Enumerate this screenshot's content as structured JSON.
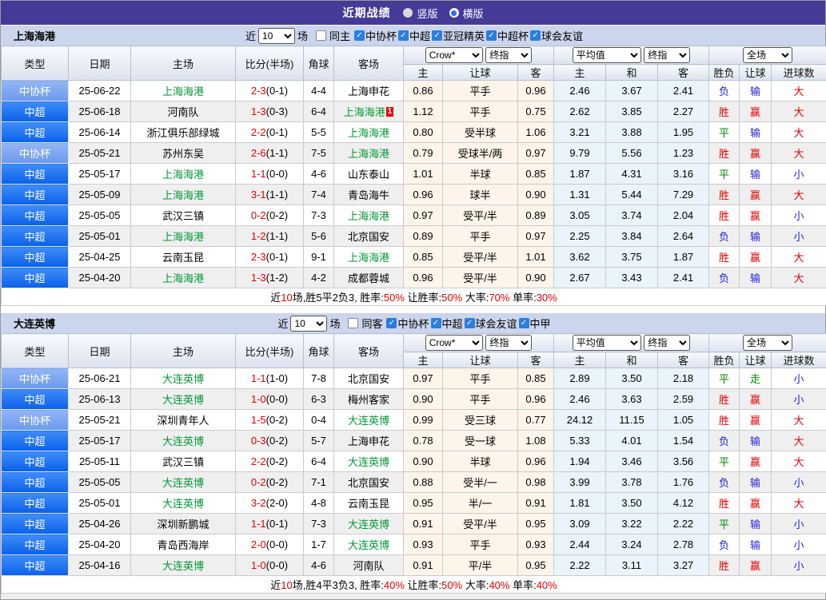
{
  "titlebar": {
    "title": "近期战绩",
    "radios": [
      {
        "label": "竖版",
        "selected": false
      },
      {
        "label": "横版",
        "selected": true
      }
    ]
  },
  "filter_labels": {
    "near": "近",
    "games": "场"
  },
  "table_header": {
    "cols": [
      "类型",
      "日期",
      "主场",
      "比分(半场)",
      "角球",
      "客场"
    ],
    "group1_selects": [
      "Crow*",
      "终指"
    ],
    "group2_selects": [
      "平均值",
      "终指"
    ],
    "group3_selects": [
      "全场"
    ],
    "sub": [
      "主",
      "让球",
      "客",
      "主",
      "和",
      "客",
      "胜负",
      "让球",
      "进球数"
    ]
  },
  "result_colors": {
    "胜": "#e60000",
    "平": "#008800",
    "负": "#2323dd",
    "赢": "#e60000",
    "输": "#2323dd",
    "走": "#008800",
    "大": "#e60000",
    "小": "#2323dd"
  },
  "sections": [
    {
      "team": "上海海港",
      "filter": {
        "count": "10",
        "same_label": "同主",
        "same_checked": false,
        "leagues": [
          {
            "label": "中协杯",
            "checked": true
          },
          {
            "label": "中超",
            "checked": true
          },
          {
            "label": "亚冠精英",
            "checked": true
          },
          {
            "label": "中超杯",
            "checked": true
          },
          {
            "label": "球会友谊",
            "checked": true
          }
        ]
      },
      "rows": [
        {
          "type": "中协杯",
          "tc": "cup",
          "date": "25-06-22",
          "home": "上海海港",
          "hg": true,
          "score": "2-3",
          "half": "(0-1)",
          "corner": "4-4",
          "away": "上海申花",
          "ag": false,
          "odds": [
            "0.86",
            "平手",
            "0.96"
          ],
          "avg": [
            "2.46",
            "3.67",
            "2.41"
          ],
          "res": [
            "负",
            "输",
            "大"
          ]
        },
        {
          "type": "中超",
          "tc": "super",
          "date": "25-06-18",
          "home": "河南队",
          "hg": false,
          "score": "1-3",
          "half": "(0-3)",
          "corner": "6-4",
          "away": "上海海港",
          "ag": true,
          "away_badge": "1",
          "odds": [
            "1.12",
            "平手",
            "0.75"
          ],
          "avg": [
            "2.62",
            "3.85",
            "2.27"
          ],
          "res": [
            "胜",
            "赢",
            "大"
          ]
        },
        {
          "type": "中超",
          "tc": "super",
          "date": "25-06-14",
          "home": "浙江俱乐部绿城",
          "hg": false,
          "score": "2-2",
          "half": "(0-1)",
          "corner": "5-5",
          "away": "上海海港",
          "ag": true,
          "odds": [
            "0.80",
            "受半球",
            "1.06"
          ],
          "avg": [
            "3.21",
            "3.88",
            "1.95"
          ],
          "res": [
            "平",
            "输",
            "大"
          ]
        },
        {
          "type": "中协杯",
          "tc": "cup",
          "date": "25-05-21",
          "home": "苏州东吴",
          "hg": false,
          "score": "2-6",
          "half": "(1-1)",
          "corner": "7-5",
          "away": "上海海港",
          "ag": true,
          "odds": [
            "0.79",
            "受球半/两",
            "0.97"
          ],
          "avg": [
            "9.79",
            "5.56",
            "1.23"
          ],
          "res": [
            "胜",
            "赢",
            "大"
          ]
        },
        {
          "type": "中超",
          "tc": "super",
          "date": "25-05-17",
          "home": "上海海港",
          "hg": true,
          "score": "1-1",
          "half": "(0-0)",
          "corner": "4-6",
          "away": "山东泰山",
          "ag": false,
          "odds": [
            "1.01",
            "半球",
            "0.85"
          ],
          "avg": [
            "1.87",
            "4.31",
            "3.16"
          ],
          "res": [
            "平",
            "输",
            "小"
          ]
        },
        {
          "type": "中超",
          "tc": "super",
          "date": "25-05-09",
          "home": "上海海港",
          "hg": true,
          "score": "3-1",
          "half": "(1-1)",
          "corner": "7-4",
          "away": "青岛海牛",
          "ag": false,
          "odds": [
            "0.96",
            "球半",
            "0.90"
          ],
          "avg": [
            "1.31",
            "5.44",
            "7.29"
          ],
          "res": [
            "胜",
            "赢",
            "大"
          ]
        },
        {
          "type": "中超",
          "tc": "super",
          "date": "25-05-05",
          "home": "武汉三镇",
          "hg": false,
          "score": "0-2",
          "half": "(0-2)",
          "corner": "7-3",
          "away": "上海海港",
          "ag": true,
          "odds": [
            "0.97",
            "受平/半",
            "0.89"
          ],
          "avg": [
            "3.05",
            "3.74",
            "2.04"
          ],
          "res": [
            "胜",
            "赢",
            "小"
          ]
        },
        {
          "type": "中超",
          "tc": "super",
          "date": "25-05-01",
          "home": "上海海港",
          "hg": true,
          "score": "1-2",
          "half": "(1-1)",
          "corner": "5-6",
          "away": "北京国安",
          "ag": false,
          "odds": [
            "0.89",
            "平手",
            "0.97"
          ],
          "avg": [
            "2.25",
            "3.84",
            "2.64"
          ],
          "res": [
            "负",
            "输",
            "小"
          ]
        },
        {
          "type": "中超",
          "tc": "super",
          "date": "25-04-25",
          "home": "云南玉昆",
          "hg": false,
          "score": "2-3",
          "half": "(0-1)",
          "corner": "9-1",
          "away": "上海海港",
          "ag": true,
          "odds": [
            "0.85",
            "受平/半",
            "1.01"
          ],
          "avg": [
            "3.62",
            "3.75",
            "1.87"
          ],
          "res": [
            "胜",
            "赢",
            "大"
          ]
        },
        {
          "type": "中超",
          "tc": "super",
          "date": "25-04-20",
          "home": "上海海港",
          "hg": true,
          "score": "1-3",
          "half": "(1-2)",
          "corner": "4-2",
          "away": "成都蓉城",
          "ag": false,
          "odds": [
            "0.96",
            "受平/半",
            "0.90"
          ],
          "avg": [
            "2.67",
            "3.43",
            "2.41"
          ],
          "res": [
            "负",
            "输",
            "大"
          ]
        }
      ],
      "summary": [
        {
          "text": "近",
          "red": false
        },
        {
          "text": "10",
          "red": true
        },
        {
          "text": "场,胜5平2负3, 胜率:",
          "red": false
        },
        {
          "text": "50%",
          "red": true
        },
        {
          "text": " 让胜率:",
          "red": false
        },
        {
          "text": "50%",
          "red": true
        },
        {
          "text": " 大率:",
          "red": false
        },
        {
          "text": "70%",
          "red": true
        },
        {
          "text": " 单率:",
          "red": false
        },
        {
          "text": "30%",
          "red": true
        }
      ]
    },
    {
      "team": "大连英博",
      "filter": {
        "count": "10",
        "same_label": "同客",
        "same_checked": false,
        "leagues": [
          {
            "label": "中协杯",
            "checked": true
          },
          {
            "label": "中超",
            "checked": true
          },
          {
            "label": "球会友谊",
            "checked": true
          },
          {
            "label": "中甲",
            "checked": true
          }
        ]
      },
      "rows": [
        {
          "type": "中协杯",
          "tc": "cup",
          "date": "25-06-21",
          "home": "大连英博",
          "hg": true,
          "score": "1-1",
          "half": "(1-0)",
          "corner": "7-8",
          "away": "北京国安",
          "ag": false,
          "odds": [
            "0.97",
            "平手",
            "0.85"
          ],
          "avg": [
            "2.89",
            "3.50",
            "2.18"
          ],
          "res": [
            "平",
            "走",
            "小"
          ]
        },
        {
          "type": "中超",
          "tc": "super",
          "date": "25-06-13",
          "home": "大连英博",
          "hg": true,
          "score": "1-0",
          "half": "(0-0)",
          "corner": "6-3",
          "away": "梅州客家",
          "ag": false,
          "odds": [
            "0.90",
            "平手",
            "0.96"
          ],
          "avg": [
            "2.46",
            "3.63",
            "2.59"
          ],
          "res": [
            "胜",
            "赢",
            "小"
          ]
        },
        {
          "type": "中协杯",
          "tc": "cup",
          "date": "25-05-21",
          "home": "深圳青年人",
          "hg": false,
          "score": "1-5",
          "half": "(0-2)",
          "corner": "0-4",
          "away": "大连英博",
          "ag": true,
          "odds": [
            "0.99",
            "受三球",
            "0.77"
          ],
          "avg": [
            "24.12",
            "11.15",
            "1.05"
          ],
          "res": [
            "胜",
            "赢",
            "大"
          ]
        },
        {
          "type": "中超",
          "tc": "super",
          "date": "25-05-17",
          "home": "大连英博",
          "hg": true,
          "score": "0-3",
          "half": "(0-2)",
          "corner": "5-7",
          "away": "上海申花",
          "ag": false,
          "odds": [
            "0.78",
            "受一球",
            "1.08"
          ],
          "avg": [
            "5.33",
            "4.01",
            "1.54"
          ],
          "res": [
            "负",
            "输",
            "大"
          ]
        },
        {
          "type": "中超",
          "tc": "super",
          "date": "25-05-11",
          "home": "武汉三镇",
          "hg": false,
          "score": "2-2",
          "half": "(0-2)",
          "corner": "6-4",
          "away": "大连英博",
          "ag": true,
          "odds": [
            "0.90",
            "半球",
            "0.96"
          ],
          "avg": [
            "1.94",
            "3.46",
            "3.56"
          ],
          "res": [
            "平",
            "赢",
            "大"
          ]
        },
        {
          "type": "中超",
          "tc": "super",
          "date": "25-05-05",
          "home": "大连英博",
          "hg": true,
          "score": "0-2",
          "half": "(0-2)",
          "corner": "7-1",
          "away": "北京国安",
          "ag": false,
          "odds": [
            "0.88",
            "受半/一",
            "0.98"
          ],
          "avg": [
            "3.99",
            "3.78",
            "1.76"
          ],
          "res": [
            "负",
            "输",
            "小"
          ]
        },
        {
          "type": "中超",
          "tc": "super",
          "date": "25-05-01",
          "home": "大连英博",
          "hg": true,
          "score": "3-2",
          "half": "(2-0)",
          "corner": "4-8",
          "away": "云南玉昆",
          "ag": false,
          "odds": [
            "0.95",
            "半/一",
            "0.91"
          ],
          "avg": [
            "1.81",
            "3.50",
            "4.12"
          ],
          "res": [
            "胜",
            "赢",
            "大"
          ]
        },
        {
          "type": "中超",
          "tc": "super",
          "date": "25-04-26",
          "home": "深圳新鹏城",
          "hg": false,
          "score": "1-1",
          "half": "(0-1)",
          "corner": "7-3",
          "away": "大连英博",
          "ag": true,
          "odds": [
            "0.91",
            "受平/半",
            "0.95"
          ],
          "avg": [
            "3.09",
            "3.22",
            "2.22"
          ],
          "res": [
            "平",
            "输",
            "小"
          ]
        },
        {
          "type": "中超",
          "tc": "super",
          "date": "25-04-20",
          "home": "青岛西海岸",
          "hg": false,
          "score": "2-0",
          "half": "(0-0)",
          "corner": "1-7",
          "away": "大连英博",
          "ag": true,
          "odds": [
            "0.93",
            "平手",
            "0.93"
          ],
          "avg": [
            "2.44",
            "3.24",
            "2.78"
          ],
          "res": [
            "负",
            "输",
            "小"
          ]
        },
        {
          "type": "中超",
          "tc": "super",
          "date": "25-04-16",
          "home": "大连英博",
          "hg": true,
          "score": "1-0",
          "half": "(0-0)",
          "corner": "4-6",
          "away": "河南队",
          "ag": false,
          "odds": [
            "0.91",
            "平/半",
            "0.95"
          ],
          "avg": [
            "2.22",
            "3.11",
            "3.27"
          ],
          "res": [
            "胜",
            "赢",
            "小"
          ]
        }
      ],
      "summary": [
        {
          "text": "近",
          "red": false
        },
        {
          "text": "10",
          "red": true
        },
        {
          "text": "场,胜4平3负3, 胜率:",
          "red": false
        },
        {
          "text": "40%",
          "red": true
        },
        {
          "text": " 让胜率:",
          "red": false
        },
        {
          "text": "50%",
          "red": true
        },
        {
          "text": " 大率:",
          "red": false
        },
        {
          "text": "40%",
          "red": true
        },
        {
          "text": " 单率:",
          "red": false
        },
        {
          "text": "40%",
          "red": true
        }
      ]
    }
  ]
}
